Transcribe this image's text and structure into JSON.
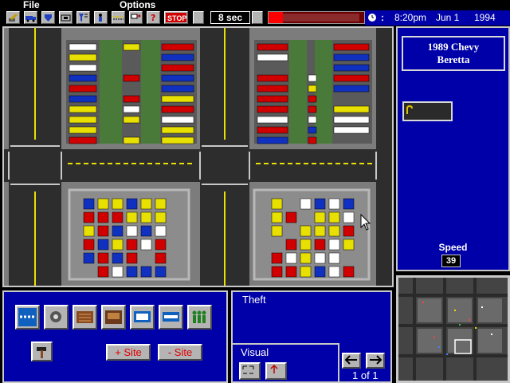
{
  "menu": {
    "file": "File",
    "options": "Options"
  },
  "toolbar": {
    "speed_value": "8 sec",
    "alarm_level_fraction": 0.15,
    "icons": [
      "edit-icon",
      "truck-icon",
      "shield-icon",
      "camera-icon",
      "filter-icon",
      "person-icon",
      "barrier-icon",
      "sign-icon",
      "car-stop-icon",
      "help-icon",
      "stop-icon",
      "blank-button",
      "blank-button-2",
      "alarm-icon"
    ]
  },
  "clock": {
    "time": "8:20pm",
    "date": "Jun 1",
    "year": "1994"
  },
  "side_panel": {
    "car_line1": "1989 Chevy",
    "car_line2": "Beretta",
    "speed_label": "Speed",
    "speed_value": "39"
  },
  "tools": {
    "items": [
      "fence-tool",
      "camera-tool",
      "gate-tool",
      "booth-tool",
      "sign-tool",
      "barrier-tool",
      "guards-tool",
      "hammer-tool"
    ],
    "add_site": "+ Site",
    "remove_site": "- Site"
  },
  "info": {
    "category": "Theft",
    "visual_label": "Visual",
    "pager": "1 of 1"
  },
  "colors": {
    "panel_blue": "#0000a8",
    "asphalt": "#2d2d2d",
    "sidewalk": "#7c7c7c",
    "grass": "#4a7a3a",
    "lane_yellow": "#e8e000",
    "alarm_red": "#ff0000"
  }
}
